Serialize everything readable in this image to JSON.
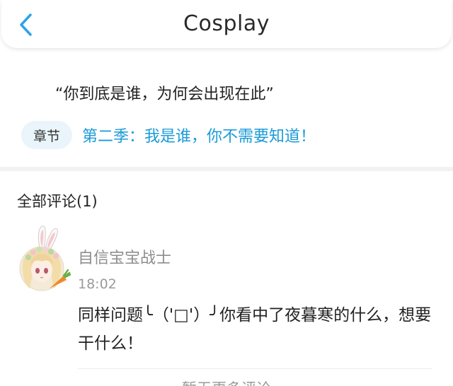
{
  "header": {
    "title": "Cosplay",
    "back_icon": "chevron-left-icon",
    "accent_color": "#2ba3e8"
  },
  "chapter": {
    "quote": "“你到底是谁，为何会出现在此”",
    "badge_label": "章节",
    "title": "第二季：我是谁，你不需要知道！",
    "title_color": "#1a9bd8"
  },
  "comments": {
    "heading": "全部评论(1)",
    "items": [
      {
        "avatar": "bunny-girl-avatar",
        "username": "自信宝宝战士",
        "time": "18:02",
        "text": "同样问题╰（'□'）╯你看中了夜暮寒的什么，想要干什么！"
      }
    ],
    "more_label": "暂无更多评论"
  }
}
